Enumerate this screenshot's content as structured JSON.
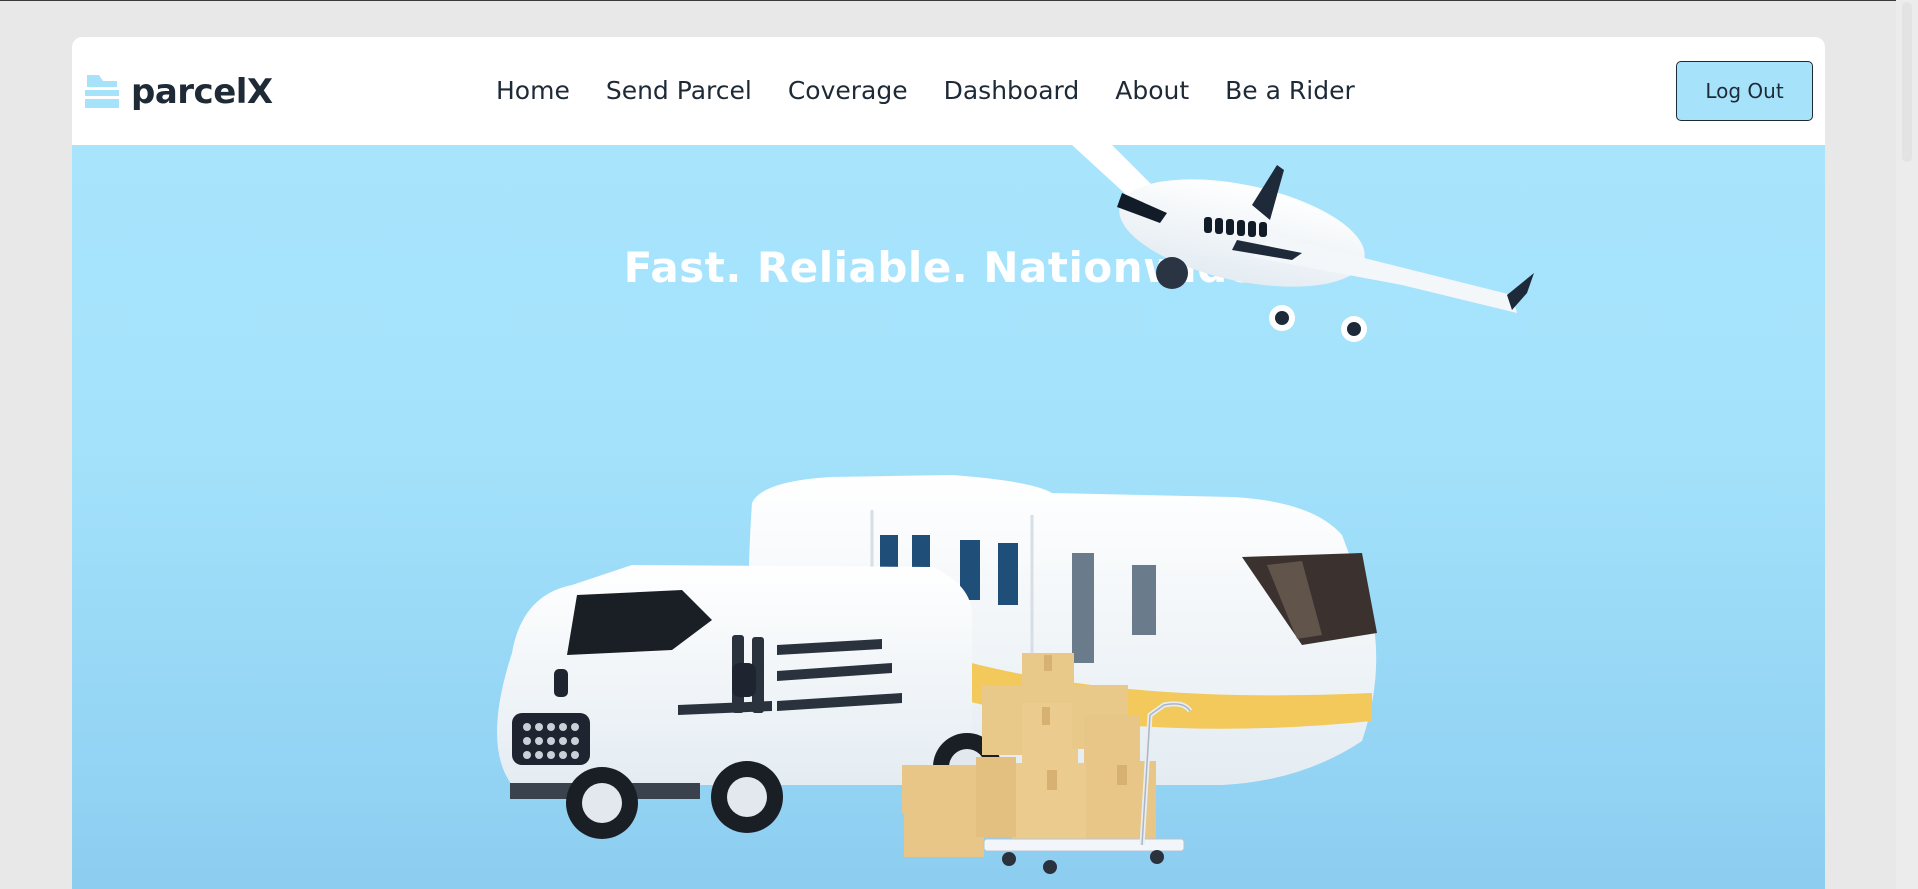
{
  "brand": {
    "name": "parcelX",
    "icon": "parcel-stack-icon",
    "color": "#1f2a37",
    "accent": "#a6e3fb"
  },
  "nav": {
    "items": [
      {
        "label": "Home"
      },
      {
        "label": "Send Parcel"
      },
      {
        "label": "Coverage"
      },
      {
        "label": "Dashboard"
      },
      {
        "label": "About"
      },
      {
        "label": "Be a Rider"
      }
    ],
    "logout_label": "Log Out"
  },
  "hero": {
    "title": "Fast. Reliable. Nationwide.",
    "background": "#a6e3fb",
    "illustration": [
      "airplane-icon",
      "delivery-van-icon",
      "train-icon",
      "parcel-boxes-icon",
      "hand-trolley-icon"
    ]
  }
}
